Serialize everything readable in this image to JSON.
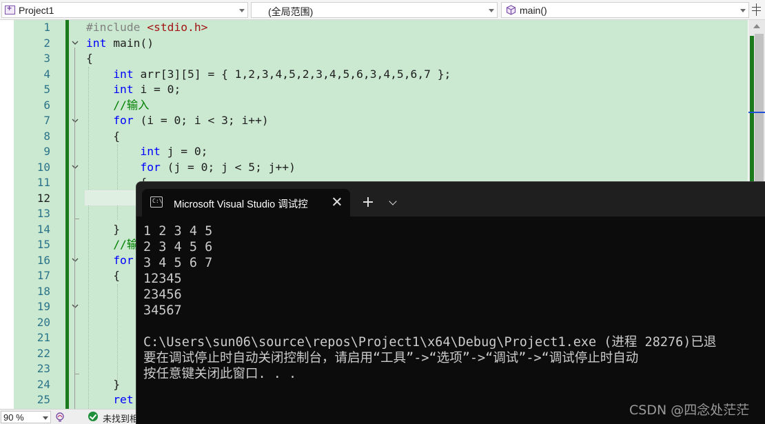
{
  "navbar": {
    "project": "Project1",
    "scope": "(全局范围)",
    "function": "main()"
  },
  "editor": {
    "line_numbers": [
      "1",
      "2",
      "3",
      "4",
      "5",
      "6",
      "7",
      "8",
      "9",
      "10",
      "11",
      "12",
      "13",
      "14",
      "15",
      "16",
      "17",
      "18",
      "19",
      "20",
      "21",
      "22",
      "23",
      "24",
      "25"
    ],
    "current_line": "12",
    "lines": [
      {
        "n": "1",
        "tokens": [
          {
            "t": "#include ",
            "c": "pp"
          },
          {
            "t": "<stdio.h>",
            "c": "str"
          }
        ]
      },
      {
        "n": "2",
        "tokens": [
          {
            "t": "int",
            "c": "kw"
          },
          {
            "t": " main()",
            "c": ""
          }
        ]
      },
      {
        "n": "3",
        "tokens": [
          {
            "t": "{",
            "c": ""
          }
        ]
      },
      {
        "n": "4",
        "tokens": [
          {
            "t": "    ",
            "c": ""
          },
          {
            "t": "int",
            "c": "kw"
          },
          {
            "t": " arr[3][5] = { 1,2,3,4,5,2,3,4,5,6,3,4,5,6,7 };",
            "c": ""
          }
        ]
      },
      {
        "n": "5",
        "tokens": [
          {
            "t": "    ",
            "c": ""
          },
          {
            "t": "int",
            "c": "kw"
          },
          {
            "t": " i = 0;",
            "c": ""
          }
        ]
      },
      {
        "n": "6",
        "tokens": [
          {
            "t": "    ",
            "c": ""
          },
          {
            "t": "//输入",
            "c": "cm"
          }
        ]
      },
      {
        "n": "7",
        "tokens": [
          {
            "t": "    ",
            "c": ""
          },
          {
            "t": "for",
            "c": "kw"
          },
          {
            "t": " (i = 0; i < 3; i++)",
            "c": ""
          }
        ]
      },
      {
        "n": "8",
        "tokens": [
          {
            "t": "    {",
            "c": ""
          }
        ]
      },
      {
        "n": "9",
        "tokens": [
          {
            "t": "        ",
            "c": ""
          },
          {
            "t": "int",
            "c": "kw"
          },
          {
            "t": " j = 0;",
            "c": ""
          }
        ]
      },
      {
        "n": "10",
        "tokens": [
          {
            "t": "        ",
            "c": ""
          },
          {
            "t": "for",
            "c": "kw"
          },
          {
            "t": " (j = 0; j < 5; j++)",
            "c": ""
          }
        ]
      },
      {
        "n": "11",
        "tokens": [
          {
            "t": "        {",
            "c": ""
          }
        ]
      },
      {
        "n": "12",
        "tokens": []
      },
      {
        "n": "13",
        "tokens": []
      },
      {
        "n": "14",
        "tokens": [
          {
            "t": "    }",
            "c": ""
          }
        ]
      },
      {
        "n": "15",
        "tokens": [
          {
            "t": "    ",
            "c": ""
          },
          {
            "t": "//输",
            "c": "cm"
          }
        ]
      },
      {
        "n": "16",
        "tokens": [
          {
            "t": "    ",
            "c": ""
          },
          {
            "t": "for",
            "c": "kw"
          }
        ]
      },
      {
        "n": "17",
        "tokens": [
          {
            "t": "    {",
            "c": ""
          }
        ]
      },
      {
        "n": "18",
        "tokens": []
      },
      {
        "n": "19",
        "tokens": []
      },
      {
        "n": "20",
        "tokens": []
      },
      {
        "n": "21",
        "tokens": []
      },
      {
        "n": "22",
        "tokens": []
      },
      {
        "n": "23",
        "tokens": []
      },
      {
        "n": "24",
        "tokens": [
          {
            "t": "    }",
            "c": ""
          }
        ]
      },
      {
        "n": "25",
        "tokens": [
          {
            "t": "    ",
            "c": ""
          },
          {
            "t": "ret",
            "c": "kw"
          }
        ]
      }
    ]
  },
  "status": {
    "zoom": "90 %",
    "message": "未找到相"
  },
  "console": {
    "tab_title": "Microsoft Visual Studio 调试控",
    "lines": [
      "1 2 3 4 5",
      "2 3 4 5 6",
      "3 4 5 6 7",
      "12345",
      "23456",
      "34567",
      "",
      "C:\\Users\\sun06\\source\\repos\\Project1\\x64\\Debug\\Project1.exe (进程 28276)已退",
      "要在调试停止时自动关闭控制台，请启用“工具”->“选项”->“调试”->“调试停止时自动",
      "按任意键关闭此窗口. . ."
    ]
  },
  "watermark": "CSDN @四念处茫茫",
  "colors": {
    "editor_bg": "#cbe8d0",
    "change_bar": "#1b7a1b",
    "keyword": "#0000ff",
    "comment": "#008000",
    "string": "#a31515",
    "console_bg": "#0c0c0c"
  }
}
